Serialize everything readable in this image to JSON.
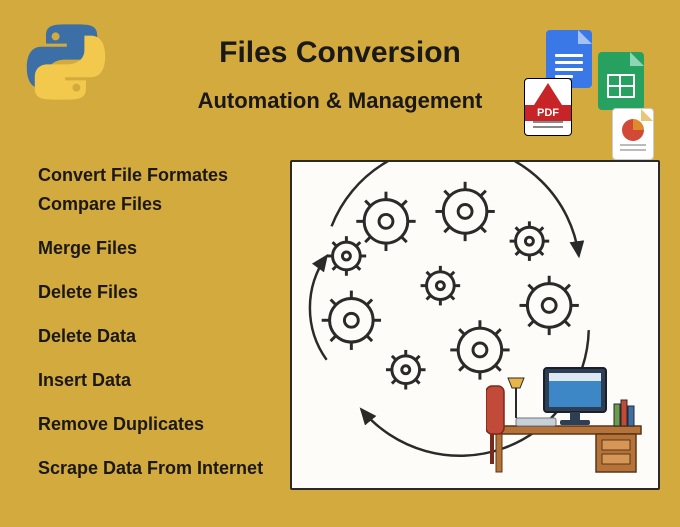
{
  "title": "Files Conversion",
  "subtitle": "Automation & Management",
  "features": [
    "Convert File Formates",
    "Compare Files",
    "Merge Files",
    "Delete Files",
    "Delete Data",
    "Insert Data",
    "Remove Duplicates",
    "Scrape Data From Internet"
  ],
  "pdf_label": "PDF",
  "icons": {
    "python": "python-logo-icon",
    "doc": "google-docs-icon",
    "sheet": "google-sheets-icon",
    "pdf": "pdf-file-icon",
    "slide": "presentation-file-icon"
  }
}
